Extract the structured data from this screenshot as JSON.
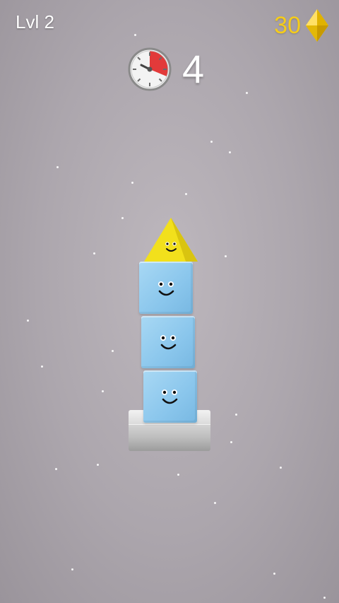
{
  "hud": {
    "level_label": "Lvl 2",
    "gem_count": "30",
    "timer_count": "4",
    "gem_icon": "yellow-gem-icon",
    "timer_icon": "stopwatch-icon"
  },
  "scene": {
    "tower_blocks": [
      "triangle",
      "cube",
      "cube",
      "cube"
    ],
    "colors": {
      "cube": "#8ac6ec",
      "triangle": "#f2e01c",
      "gem": "#f5cc1a",
      "timer_fill": "#e23a3a",
      "background": "#aca6ad"
    }
  }
}
